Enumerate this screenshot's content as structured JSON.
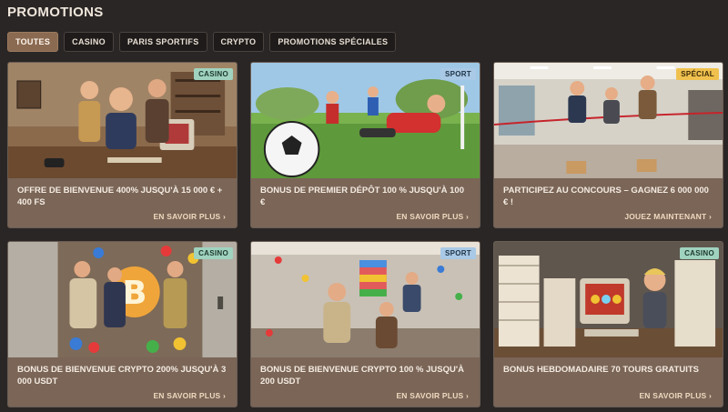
{
  "page": {
    "title": "PROMOTIONS"
  },
  "filters": [
    {
      "label": "TOUTES",
      "active": true
    },
    {
      "label": "CASINO",
      "active": false
    },
    {
      "label": "PARIS SPORTIFS",
      "active": false
    },
    {
      "label": "CRYPTO",
      "active": false
    },
    {
      "label": "PROMOTIONS SPÉCIALES",
      "active": false
    }
  ],
  "promotions": [
    {
      "badge": "CASINO",
      "badge_type": "casino",
      "title": "OFFRE DE BIENVENUE 400% JUSQU'À 15 000 € + 400 FS",
      "cta": "EN SAVOIR PLUS ›",
      "image": "casino-office-illustration"
    },
    {
      "badge": "SPORT",
      "badge_type": "sport",
      "title": "BONUS DE PREMIER DÉPÔT 100 % JUSQU'À 100 €",
      "cta": "EN SAVOIR PLUS ›",
      "image": "football-illustration"
    },
    {
      "badge": "SPÉCIAL",
      "badge_type": "special",
      "title": "PARTICIPEZ AU CONCOURS – GAGNEZ 6 000 000 € !",
      "cta": "JOUEZ MAINTENANT ›",
      "image": "office-race-illustration"
    },
    {
      "badge": "CASINO",
      "badge_type": "casino",
      "title": "BONUS DE BIENVENUE CRYPTO 200% JUSQU'À 3 000 USDT",
      "cta": "EN SAVOIR PLUS ›",
      "image": "bitcoin-elevator-illustration"
    },
    {
      "badge": "SPORT",
      "badge_type": "sport",
      "title": "BONUS DE BIENVENUE CRYPTO 100 % JUSQU'À 200 USDT",
      "cta": "EN SAVOIR PLUS ›",
      "image": "office-party-illustration"
    },
    {
      "badge": "CASINO",
      "badge_type": "casino",
      "title": "BONUS HEBDOMADAIRE 70 TOURS GRATUITS",
      "cta": "EN SAVOIR PLUS ›",
      "image": "paperwork-slots-illustration"
    }
  ],
  "colors": {
    "background": "#2a2625",
    "card": "#7a6557",
    "active_filter": "#8a6a51",
    "badge_casino": "#9fd3bf",
    "badge_sport": "#a9c9e6",
    "badge_special": "#f0c14e"
  }
}
